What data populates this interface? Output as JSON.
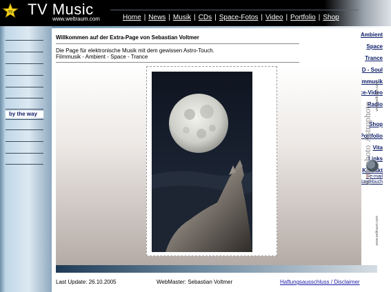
{
  "header": {
    "title": "TV Music",
    "url": "www.weltraum.com",
    "nav": [
      {
        "label": "Home"
      },
      {
        "label": "News"
      },
      {
        "label": "Musik"
      },
      {
        "label": "CDs"
      },
      {
        "label": "Space-Fotos"
      },
      {
        "label": "Video"
      },
      {
        "label": "Portfolio"
      },
      {
        "label": "Shop"
      }
    ],
    "separator": "|"
  },
  "sidebar": {
    "items": [
      {
        "label": "Ambient"
      },
      {
        "label": "Space"
      },
      {
        "label": "Trance"
      },
      {
        "label": "D - Soul"
      },
      {
        "label": "Filmmusik"
      },
      {
        "label": "Space-Video"
      },
      {
        "label": "Radio"
      },
      {
        "label": "by the way"
      },
      {
        "label": "Shop"
      },
      {
        "label": "Portfolio"
      },
      {
        "label": "Vita"
      },
      {
        "label": "Links"
      },
      {
        "label": "Kontakt"
      }
    ],
    "active_item": "by the way",
    "sub_items": [
      {
        "label": "e-mail"
      },
      {
        "label": "Gästebuch"
      }
    ],
    "sub_arrow": ">"
  },
  "main": {
    "welcome": "Willkommen auf der Extra-Page von Sebastian Voltmer",
    "intro_line1": "Die Page für elektronische Musik mit dem gewissen Astro-Touch.",
    "intro_line2": "Filmmusik - Ambient - Space - Trance"
  },
  "side_logo": {
    "text_outer": "Astrophoto",
    "text_inner": "Astrophoto",
    "url": "www.weltraum.com"
  },
  "footer": {
    "last_update": "Last Update: 26.10.2005",
    "webmaster": "WebMaster: Sebastian Voltmer",
    "disclaimer": "Haftungsausschluss / Disclaimer"
  },
  "colors": {
    "header_bg": "#000000",
    "nav_link": "#0a1a66",
    "footer_link": "#1a1aa6",
    "sidebar_light": "#dce9f2",
    "sidebar_dark": "#8fa9bf"
  },
  "icons": {
    "logo": "yellow-star-icon",
    "sub_arrow": "arrow-right-icon"
  }
}
